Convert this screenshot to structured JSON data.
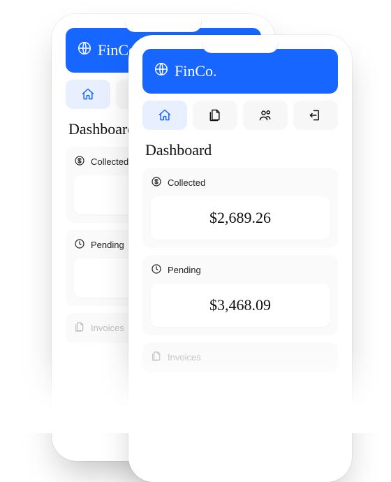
{
  "brand": {
    "name": "FinCo."
  },
  "nav": {
    "items": [
      {
        "name": "home"
      },
      {
        "name": "documents"
      },
      {
        "name": "people"
      },
      {
        "name": "logout"
      }
    ]
  },
  "page": {
    "title": "Dashboard"
  },
  "cards": {
    "collected": {
      "label": "Collected",
      "value": "$2,689.26"
    },
    "pending": {
      "label": "Pending",
      "value": "$3,468.09"
    },
    "invoices": {
      "label": "Invoices"
    }
  },
  "colors": {
    "brand": "#1766ff",
    "navActiveBg": "#e8f0ff"
  }
}
